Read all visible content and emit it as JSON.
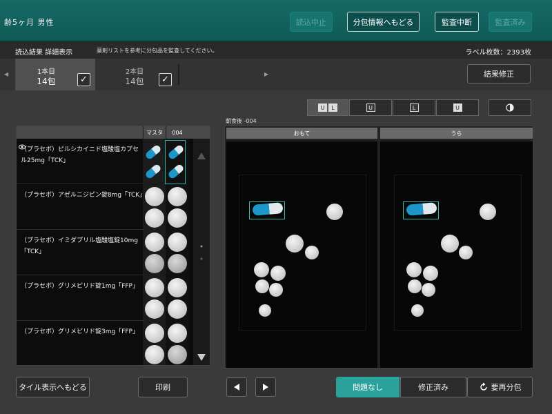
{
  "header": {
    "title": "齢5ヶ月 男性",
    "buttons": {
      "read_stop": "読込中止",
      "back_dispense": "分包情報へもどる",
      "audit_stop": "監査中断",
      "audit_done": "監査済み"
    }
  },
  "subheader": {
    "mode": "読込結果 詳細表示",
    "instruction": "薬剤リストを参考に分包品を監査してください。",
    "label_count": "ラベル枚数：2393枚"
  },
  "tabs": [
    {
      "line1": "1本目",
      "line2": "14包",
      "checked": "✓"
    },
    {
      "line1": "2本目",
      "line2": "14包",
      "checked": "✓"
    }
  ],
  "buttons": {
    "result_fix": "結果修正",
    "back_tile": "タイル表示へもどる",
    "print": "印刷",
    "no_problem": "問題なし",
    "fixed": "修正済み",
    "redispense": "要再分包"
  },
  "view_toggle": {
    "both": [
      "U",
      "L"
    ],
    "upper": "U",
    "lower": "L",
    "flip": "U",
    "contrast_icon": "half-circle-icon"
  },
  "drug_list": {
    "columns": [
      "マスタ",
      "004"
    ],
    "drugs": [
      {
        "name": "（プラセボ）ピルシカイニド塩酸塩カプセル25mg「TCK」"
      },
      {
        "name": "（プラセボ）アゼルニジピン錠8mg「TCK」"
      },
      {
        "name": "（プラセボ）イミダプリル塩酸塩錠10mg「TCK」"
      },
      {
        "name": "（プラセボ）グリメピリド錠1mg「FFP」"
      },
      {
        "name": "（プラセボ）グリメピリド錠3mg「FFP」"
      }
    ]
  },
  "image_view": {
    "label": "朝食後 -004",
    "front": "おもて",
    "back": "うら"
  },
  "colors": {
    "accent": "#2aa29b",
    "header": "#176a66"
  }
}
